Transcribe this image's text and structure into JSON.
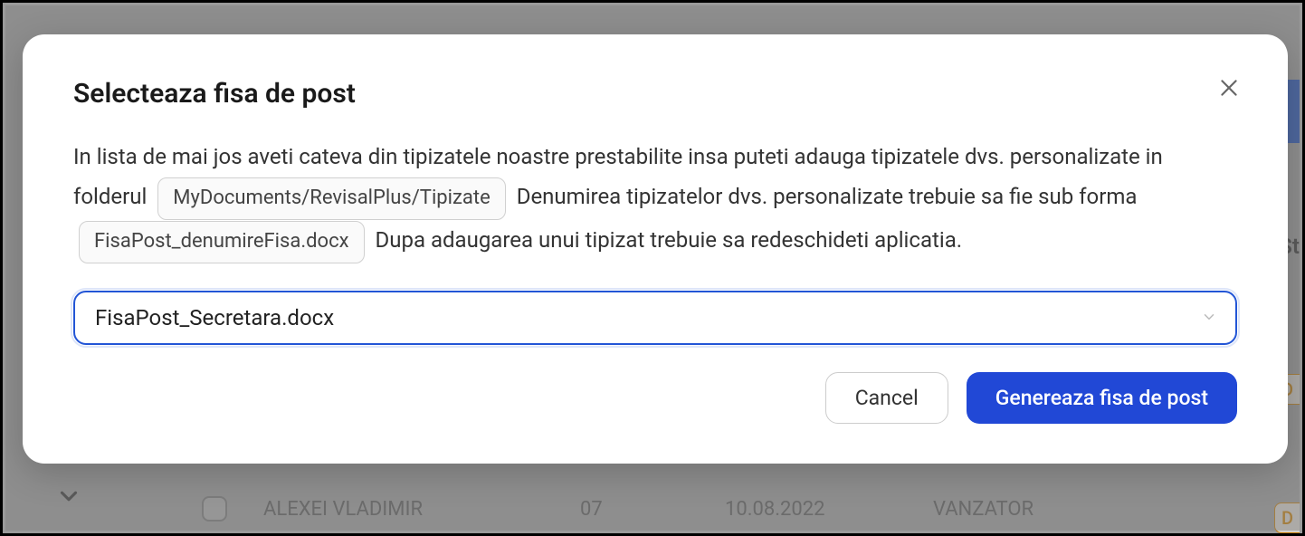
{
  "modal": {
    "title": "Selecteaza fisa de post",
    "description": {
      "part1": "In lista de mai jos aveti cateva din tipizatele noastre prestabilite insa puteti adauga tipizatele dvs. personalizate in folderul",
      "chip1": "MyDocuments/RevisalPlus/Tipizate",
      "part2": "Denumirea tipizatelor dvs. personalizate trebuie sa fie sub forma",
      "chip2": "FisaPost_denumireFisa.docx",
      "part3": "Dupa adaugarea unui tipizat trebuie sa redeschideti aplicatia."
    },
    "select_value": "FisaPost_Secretara.docx",
    "cancel_label": "Cancel",
    "primary_label": "Genereaza fisa de post"
  },
  "background": {
    "row": {
      "name": "ALEXEI VLADIMIR",
      "col2": "07",
      "col3": "10.08.2022",
      "col4": "VANZATOR"
    },
    "badge": "D",
    "partial_text": "St"
  }
}
